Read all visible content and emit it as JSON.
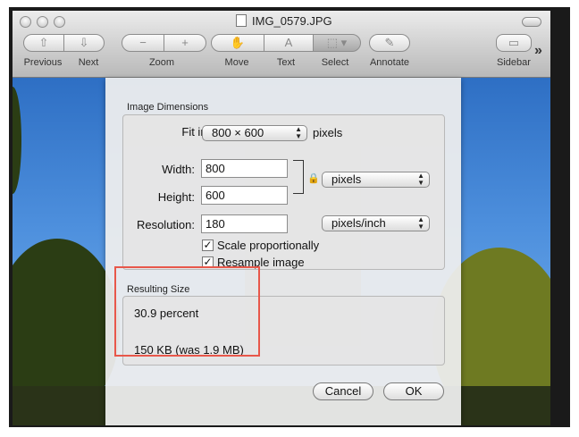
{
  "window": {
    "title": "IMG_0579.JPG",
    "toolbar": {
      "previous": "Previous",
      "next": "Next",
      "zoom": "Zoom",
      "move": "Move",
      "text": "Text",
      "select": "Select",
      "annotate": "Annotate",
      "sidebar": "Sidebar",
      "overflow": "»"
    }
  },
  "dialog": {
    "image_dimensions": {
      "label": "Image Dimensions",
      "fit_into_label": "Fit into:",
      "fit_into_value": "800 × 600",
      "fit_into_unit": "pixels",
      "width_label": "Width:",
      "width_value": "800",
      "height_label": "Height:",
      "height_value": "600",
      "size_unit": "pixels",
      "resolution_label": "Resolution:",
      "resolution_value": "180",
      "resolution_unit": "pixels/inch",
      "scale_label": "Scale proportionally",
      "scale_checked": true,
      "resample_label": "Resample image",
      "resample_checked": true
    },
    "resulting_size": {
      "label": "Resulting Size",
      "percent": "30.9 percent",
      "size": "150 KB (was 1.9 MB)"
    },
    "buttons": {
      "cancel": "Cancel",
      "ok": "OK"
    }
  },
  "colors": {
    "highlight": "#e8574a"
  }
}
